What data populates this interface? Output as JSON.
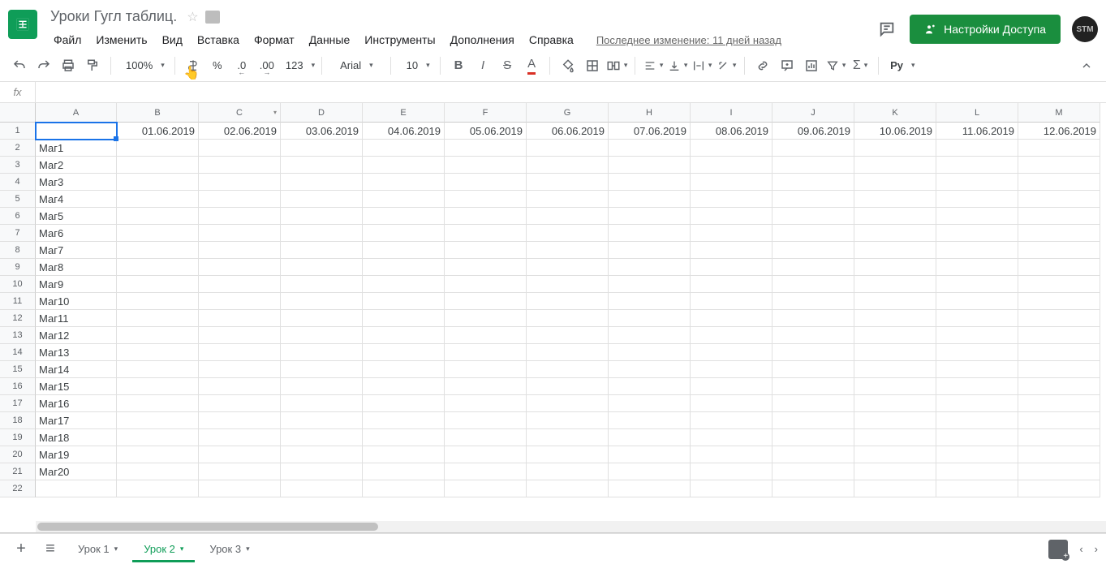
{
  "doc_title": "Уроки Гугл таблиц.",
  "menus": [
    "Файл",
    "Изменить",
    "Вид",
    "Вставка",
    "Формат",
    "Данные",
    "Инструменты",
    "Дополнения",
    "Справка"
  ],
  "last_edit": "Последнее изменение: 11 дней назад",
  "share_label": "Настройки Доступа",
  "avatar": "STM",
  "toolbar": {
    "zoom": "100%",
    "percent": "%",
    "dec0": ".0",
    "dec00": ".00",
    "format123": "123",
    "font": "Arial",
    "font_size": "10",
    "cyrillic": "Ру"
  },
  "fx": "fx",
  "columns": [
    "A",
    "B",
    "C",
    "D",
    "E",
    "F",
    "G",
    "H",
    "I",
    "J",
    "K",
    "L",
    "M"
  ],
  "rows_count": 22,
  "row1": [
    "",
    "01.06.2019",
    "02.06.2019",
    "03.06.2019",
    "04.06.2019",
    "05.06.2019",
    "06.06.2019",
    "07.06.2019",
    "08.06.2019",
    "09.06.2019",
    "10.06.2019",
    "11.06.2019",
    "12.06.2019"
  ],
  "colA": [
    "",
    "Маг1",
    "Маг2",
    "Маг3",
    "Маг4",
    "Маг5",
    "Маг6",
    "Маг7",
    "Маг8",
    "Маг9",
    "Маг10",
    "Маг11",
    "Маг12",
    "Маг13",
    "Маг14",
    "Маг15",
    "Маг16",
    "Маг17",
    "Маг18",
    "Маг19",
    "Маг20",
    ""
  ],
  "tabs": [
    {
      "label": "Урок 1",
      "active": false
    },
    {
      "label": "Урок 2",
      "active": true
    },
    {
      "label": "Урок 3",
      "active": false
    }
  ]
}
